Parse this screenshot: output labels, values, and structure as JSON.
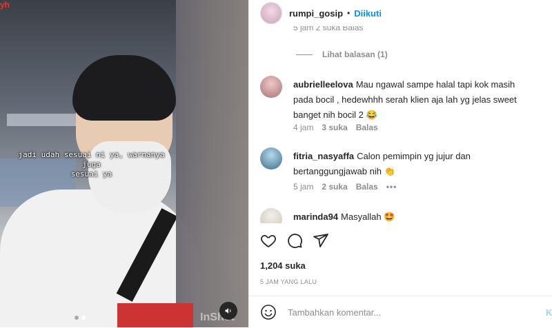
{
  "media": {
    "caption_line1": "jadi udah sesuai ni ya, warnanya juga",
    "caption_line2": "sesuai ya",
    "corner_tag": "yh",
    "watermark": "InShot",
    "sound_icon": "speaker-icon",
    "carousel_dots": 2,
    "carousel_active": 2
  },
  "header": {
    "username": "rumpi_gosip",
    "separator": "•",
    "follow_label": "Diikuti"
  },
  "comments": {
    "faded_meta": "5 jam   2 suka   Balas",
    "view_replies": "Lihat balasan (1)",
    "items": [
      {
        "user": "aubrielleelova",
        "text": "Mau ngawal sampe halal tapi kok masih pada bocil , hedewhhh serah klien aja lah yg jelas sweet banget nih bocil 2 😂",
        "time": "4 jam",
        "likes": "3 suka",
        "reply": "Balas"
      },
      {
        "user": "fitria_nasyaffa",
        "text": "Calon pemimpin yg jujur dan bertanggungjawab nih 👏",
        "time": "5 jam",
        "likes": "2 suka",
        "reply": "Balas",
        "more": "•••"
      },
      {
        "user": "marinda94",
        "text": "Masyallah 🤩"
      }
    ]
  },
  "actions": {
    "like_icon": "heart-icon",
    "comment_icon": "comment-bubble-icon",
    "share_icon": "paper-plane-icon"
  },
  "likes_count": "1,204 suka",
  "post_time": "5 JAM YANG LALU",
  "composer": {
    "emoji_icon": "smiley-icon",
    "placeholder": "Tambahkan komentar...",
    "post_label": "Kirim"
  },
  "colors": {
    "link_blue": "#0095f6",
    "muted_text": "#8e8e8e",
    "text": "#262626"
  }
}
